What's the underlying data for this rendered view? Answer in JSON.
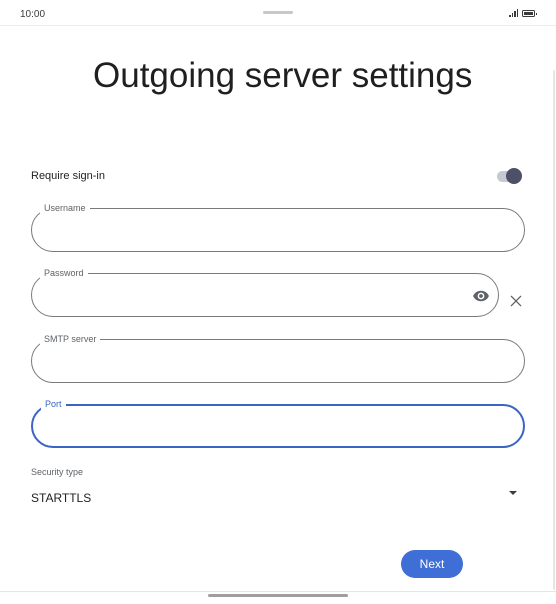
{
  "status_bar": {
    "time": "10:00"
  },
  "title": "Outgoing server settings",
  "require_signin": {
    "label": "Require sign-in",
    "enabled": true
  },
  "fields": {
    "username": {
      "label": "Username",
      "value": ""
    },
    "password": {
      "label": "Password",
      "value": ""
    },
    "smtp_server": {
      "label": "SMTP server",
      "value": ""
    },
    "port": {
      "label": "Port",
      "value": ""
    }
  },
  "security": {
    "label": "Security type",
    "value": "STARTTLS"
  },
  "next_button": {
    "label": "Next"
  },
  "icons": {
    "toggle": "switch-icon",
    "password_visibility": "eye-icon",
    "clear": "close-icon",
    "dropdown": "dropdown-arrow-icon"
  },
  "colors": {
    "accent": "#3f6fd6",
    "focus": "#3b64c4",
    "toggle_thumb": "#4d5066",
    "toggle_track": "#c6c8d2"
  }
}
